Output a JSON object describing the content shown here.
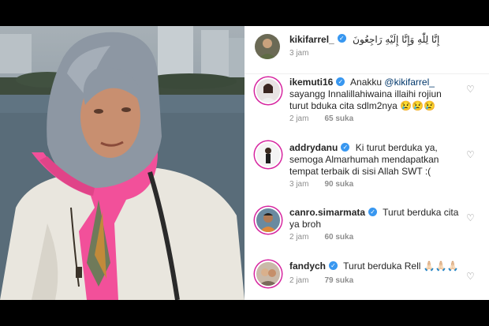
{
  "post": {
    "username": "kikifarrel_",
    "caption": "إِنَّا لِلّٰهِ وَإِنَّا إِلَيْهِ رَاجِعُونَ",
    "time": "3 jam"
  },
  "comments": [
    {
      "username": "ikemuti16",
      "mention": "@kikifarrel_",
      "text_before": "Anakku ",
      "text_after": " sayangg Innalillahiwaina illaihi rojiun turut bduka cita sdlm2nya 😢😢😢",
      "time": "2 jam",
      "likes": "65 suka"
    },
    {
      "username": "addrydanu",
      "text": "Ki turut berduka ya, semoga Almarhumah mendapatkan tempat terbaik di sisi Allah SWT :(",
      "time": "3 jam",
      "likes": "90 suka"
    },
    {
      "username": "canro.simarmata",
      "text": "Turut berduka cita ya broh",
      "time": "2 jam",
      "likes": "60 suka"
    },
    {
      "username": "fandych",
      "text": "Turut berduka Rell 🙏🏻🙏🏻🙏🏻",
      "time": "2 jam",
      "likes": "79 suka"
    }
  ],
  "icons": {
    "verified": "verified-badge-icon",
    "like": "heart-outline-icon"
  },
  "colors": {
    "verified": "#3897f0",
    "scarf": "#f2509a",
    "hijab": "#8d97a3"
  }
}
